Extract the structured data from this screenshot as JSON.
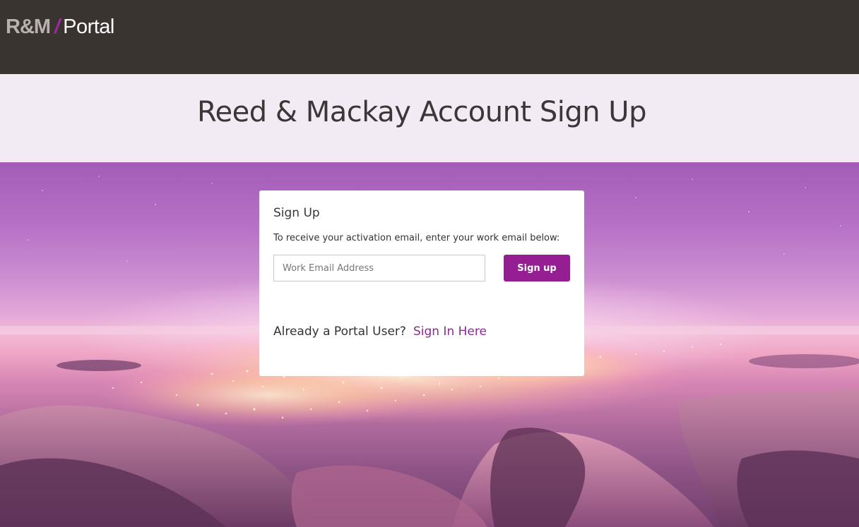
{
  "header": {
    "logo": {
      "brand": "R&M",
      "slash": "/",
      "product": "Portal"
    }
  },
  "page": {
    "title": "Reed & Mackay Account Sign Up"
  },
  "signup_card": {
    "heading": "Sign Up",
    "instruction": "To receive your activation email, enter your work email below:",
    "email_field": {
      "value": "",
      "placeholder": "Work Email Address"
    },
    "signup_button_label": "Sign up",
    "existing_user_prompt": "Already a Portal User?",
    "signin_link_label": "Sign In Here"
  },
  "colors": {
    "header_bg": "#3a3431",
    "title_band_bg": "#f3ebf3",
    "accent": "#941e92",
    "link": "#8a2b8f"
  }
}
